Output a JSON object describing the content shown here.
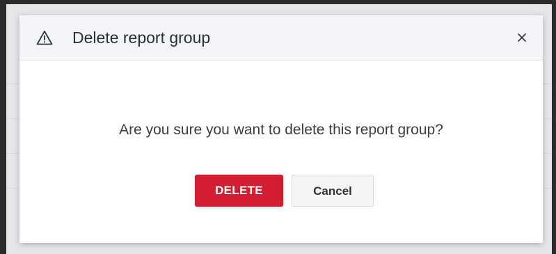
{
  "dialog": {
    "title": "Delete report group",
    "header_icon": "warning-triangle-icon",
    "close_icon": "close-icon",
    "message": "Are you sure you want to delete this report group?",
    "delete_label": "DELETE",
    "cancel_label": "Cancel"
  },
  "colors": {
    "delete_button": "#d21d33",
    "header_background": "#f3f5f8",
    "cancel_button": "#f4f5f7"
  }
}
